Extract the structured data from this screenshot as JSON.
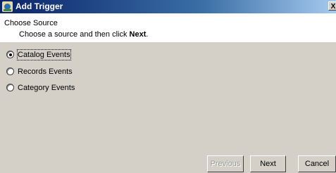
{
  "window": {
    "title": "Add Trigger",
    "close_glyph": "X",
    "app_icon": "trigger-app-icon"
  },
  "header": {
    "title": "Choose Source",
    "instruction_prefix": "Choose a source and then click ",
    "instruction_emphasis": "Next",
    "instruction_suffix": "."
  },
  "options": {
    "selected": "Catalog Events",
    "items": [
      {
        "label": "Catalog Events",
        "checked": true
      },
      {
        "label": "Records Events",
        "checked": false
      },
      {
        "label": "Category Events",
        "checked": false
      }
    ]
  },
  "buttons": {
    "previous": {
      "label": "Previous",
      "enabled": false
    },
    "next": {
      "label": "Next",
      "enabled": true
    },
    "cancel": {
      "label": "Cancel",
      "enabled": true
    }
  }
}
